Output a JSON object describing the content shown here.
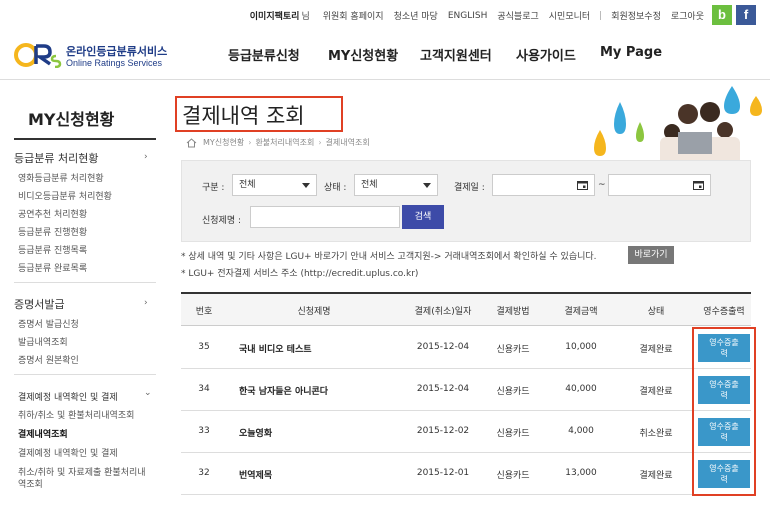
{
  "topbar": {
    "user_name": "이미지팩토리",
    "user_suffix": "님",
    "links": [
      "위원회 홈페이지",
      "청소년 마당",
      "ENGLISH",
      "공식블로그",
      "시민모니터"
    ],
    "account_links": [
      "회원정보수정",
      "로그아웃"
    ],
    "blog_icon_label": "b",
    "facebook_icon_label": "f"
  },
  "logo": {
    "korean": "온라인등급분류서비스",
    "english": "Online Ratings Services"
  },
  "gnb": [
    "등급분류신청",
    "MY신청현황",
    "고객지원센터",
    "사용가이드",
    "My Page"
  ],
  "sidebar": {
    "title": "MY신청현황",
    "group1": {
      "label": "등급분류 처리현황",
      "items": [
        "영화등급분류 처리현황",
        "비디오등급분류 처리현황",
        "공연추천 처리현황",
        "등급분류 진행현황",
        "등급분류 진행목록",
        "등급분류 완료목록"
      ]
    },
    "group2": {
      "label": "증명서발급",
      "items": [
        "증명서 발급신청",
        "발급내역조회",
        "증명서 원본확인"
      ]
    },
    "group3": {
      "label": "결제예정 내역확인 및 결제",
      "items": [
        "취하/취소 및 환불처리내역조회",
        "결제내역조회",
        "결제예정 내역확인 및 결제",
        "취소/취하 및 자료제출 환불처리내",
        "역조회"
      ]
    }
  },
  "page": {
    "title": "결제내역 조회",
    "breadcrumb": [
      "MY신청현황",
      "환불처리내역조회",
      "결제내역조회"
    ]
  },
  "search": {
    "category_label": "구분 :",
    "category_value": "전체",
    "status_label": "상태 :",
    "status_value": "전체",
    "date_label": "결제일 :",
    "date_sep": "~",
    "name_label": "신청제명 :",
    "button": "검색"
  },
  "notes": {
    "line1": "* 상세 내역 및 기타 사항은 LGU+ 바로가기 안내 서비스 고객지원-> 거래내역조회에서 확인하실 수 있습니다.",
    "go_button": "바로가기",
    "line2": "* LGU+ 전자결제 서비스 주소 (http://ecredit.uplus.co.kr)"
  },
  "table": {
    "headers": [
      "번호",
      "신청제명",
      "결제(취소)일자",
      "결제방법",
      "결제금액",
      "상태",
      "영수증출력"
    ],
    "rows": [
      {
        "no": "35",
        "title": "국내 비디오 테스트",
        "date": "2015-12-04",
        "method": "신용카드",
        "amount": "10,000",
        "status": "결제완료",
        "receipt_l1": "영수증출",
        "receipt_l2": "력"
      },
      {
        "no": "34",
        "title": "한국 남자들은 아니콘다",
        "date": "2015-12-04",
        "method": "신용카드",
        "amount": "40,000",
        "status": "결제완료",
        "receipt_l1": "영수증출",
        "receipt_l2": "력"
      },
      {
        "no": "33",
        "title": "오늘영화",
        "date": "2015-12-02",
        "method": "신용카드",
        "amount": "4,000",
        "status": "취소완료",
        "receipt_l1": "영수증출",
        "receipt_l2": "력"
      },
      {
        "no": "32",
        "title": "번역제목",
        "date": "2015-12-01",
        "method": "신용카드",
        "amount": "13,000",
        "status": "결제완료",
        "receipt_l1": "영수증출",
        "receipt_l2": "력"
      }
    ]
  },
  "colors": {
    "accent_red": "#e04024",
    "search_button": "#3d4ba8",
    "receipt_button": "#3a97c9",
    "logo_blue": "#1f3c87"
  }
}
